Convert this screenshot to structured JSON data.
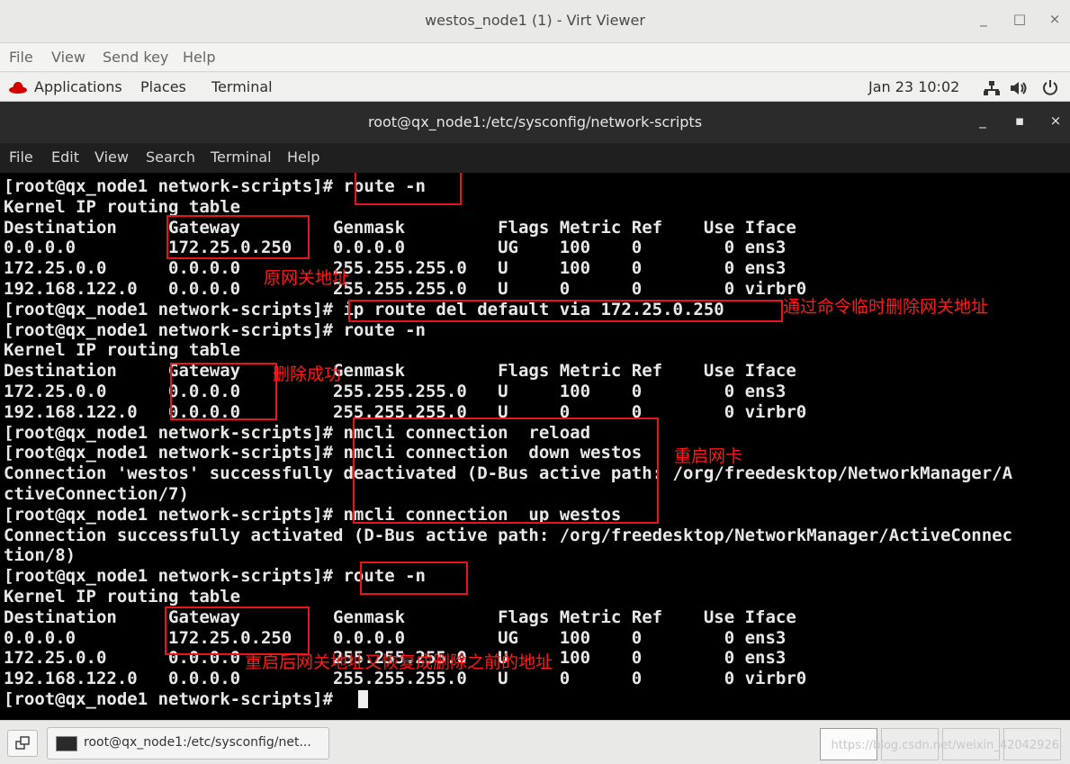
{
  "outer_window": {
    "title": "westos_node1 (1) - Virt Viewer",
    "controls": {
      "minimize": "_",
      "maximize": "□",
      "close": "×"
    },
    "menu": [
      "File",
      "View",
      "Send key",
      "Help"
    ]
  },
  "gnome_panel": {
    "applications": "Applications",
    "places": "Places",
    "terminal": "Terminal",
    "clock": "Jan 23  10:02"
  },
  "terminal": {
    "title": "root@qx_node1:/etc/sysconfig/network-scripts",
    "controls": {
      "minimize": "_",
      "maximize": "▪",
      "close": "×"
    },
    "menu": [
      "File",
      "Edit",
      "View",
      "Search",
      "Terminal",
      "Help"
    ],
    "lines": [
      "[root@qx_node1 network-scripts]# route -n",
      "Kernel IP routing table",
      "Destination     Gateway         Genmask         Flags Metric Ref    Use Iface",
      "0.0.0.0         172.25.0.250    0.0.0.0         UG    100    0        0 ens3",
      "172.25.0.0      0.0.0.0         255.255.255.0   U     100    0        0 ens3",
      "192.168.122.0   0.0.0.0         255.255.255.0   U     0      0        0 virbr0",
      "[root@qx_node1 network-scripts]# ip route del default via 172.25.0.250",
      "[root@qx_node1 network-scripts]# route -n",
      "Kernel IP routing table",
      "Destination     Gateway         Genmask         Flags Metric Ref    Use Iface",
      "172.25.0.0      0.0.0.0         255.255.255.0   U     100    0        0 ens3",
      "192.168.122.0   0.0.0.0         255.255.255.0   U     0      0        0 virbr0",
      "[root@qx_node1 network-scripts]# nmcli connection  reload",
      "[root@qx_node1 network-scripts]# nmcli connection  down westos",
      "Connection 'westos' successfully deactivated (D-Bus active path: /org/freedesktop/NetworkManager/A",
      "ctiveConnection/7)",
      "[root@qx_node1 network-scripts]# nmcli connection  up westos",
      "Connection successfully activated (D-Bus active path: /org/freedesktop/NetworkManager/ActiveConnec",
      "tion/8)",
      "[root@qx_node1 network-scripts]# route -n",
      "Kernel IP routing table",
      "Destination     Gateway         Genmask         Flags Metric Ref    Use Iface",
      "0.0.0.0         172.25.0.250    0.0.0.0         UG    100    0        0 ens3",
      "172.25.0.0      0.0.0.0         255.255.255.0   U     100    0        0 ens3",
      "192.168.122.0   0.0.0.0         255.255.255.0   U     0      0        0 virbr0",
      "[root@qx_node1 network-scripts]# "
    ]
  },
  "annotations": {
    "original_gateway": "原网关地址",
    "temp_delete": "通过命令临时删除网关地址",
    "delete_success": "删除成功",
    "restart_nic": "重启网卡",
    "restored": "重启后网关地址又恢复成删除之前的地址"
  },
  "taskbar": {
    "task_label": "root@qx_node1:/etc/sysconfig/net...",
    "watermark": "https://blog.csdn.net/weixin_42042926"
  },
  "colors": {
    "annotation": "#e8141b",
    "terminal_bg": "#000000",
    "terminal_fg": "#e8e8e8"
  }
}
